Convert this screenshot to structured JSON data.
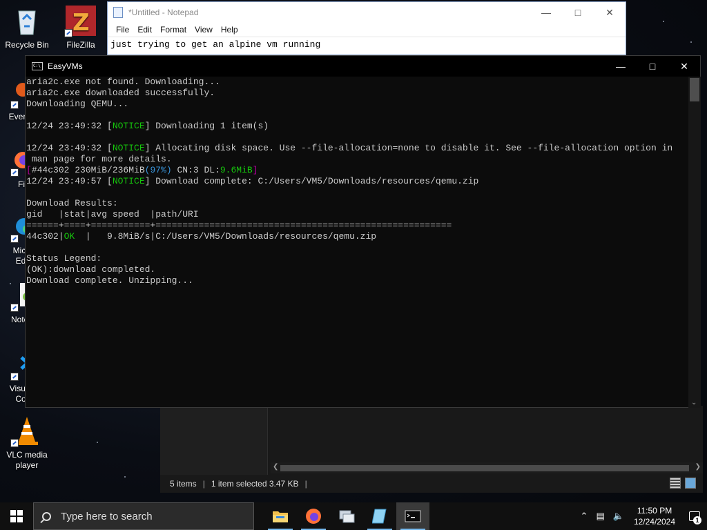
{
  "desktop": {
    "icons": [
      {
        "label": "Recycle Bin",
        "icon": "recycle-bin-icon"
      },
      {
        "label": "FileZilla",
        "icon": "filezilla-icon"
      },
      {
        "label": "Every",
        "icon": "everything-icon"
      },
      {
        "label": "Fir",
        "icon": "firefox-icon"
      },
      {
        "label": "Micr\nEd",
        "icon": "edge-icon"
      },
      {
        "label": "Notep",
        "icon": "notepad-plus-icon"
      },
      {
        "label": "Visual\nCo",
        "icon": "vscode-icon"
      },
      {
        "label": "VLC media\nplayer",
        "icon": "vlc-icon"
      }
    ]
  },
  "notepad": {
    "title": "*Untitled - Notepad",
    "menu": [
      "File",
      "Edit",
      "Format",
      "View",
      "Help"
    ],
    "content": "just trying to get an alpine vm running"
  },
  "console": {
    "title": "EasyVMs",
    "lines": [
      [
        {
          "t": "aria2c.exe not found. Downloading..."
        }
      ],
      [
        {
          "t": "aria2c.exe downloaded successfully."
        }
      ],
      [
        {
          "t": "Downloading QEMU..."
        }
      ],
      [
        {
          "t": ""
        }
      ],
      [
        {
          "t": "12/24 23:49:32 ["
        },
        {
          "t": "NOTICE",
          "c": "green"
        },
        {
          "t": "] Downloading 1 item(s)"
        }
      ],
      [
        {
          "t": ""
        }
      ],
      [
        {
          "t": "12/24 23:49:32 ["
        },
        {
          "t": "NOTICE",
          "c": "green"
        },
        {
          "t": "] Allocating disk space. Use --file-allocation=none to disable it. See --file-allocation option in"
        }
      ],
      [
        {
          "t": " man page for more details."
        }
      ],
      [
        {
          "t": "[",
          "c": "mag"
        },
        {
          "t": "#44c302 230MiB/236MiB"
        },
        {
          "t": "(97%)",
          "c": "cyan"
        },
        {
          "t": " CN:3 DL:"
        },
        {
          "t": "9.6MiB",
          "c": "green"
        },
        {
          "t": "]",
          "c": "mag"
        }
      ],
      [
        {
          "t": "12/24 23:49:57 ["
        },
        {
          "t": "NOTICE",
          "c": "green"
        },
        {
          "t": "] Download complete: C:/Users/VM5/Downloads/resources/qemu.zip"
        }
      ],
      [
        {
          "t": ""
        }
      ],
      [
        {
          "t": "Download Results:"
        }
      ],
      [
        {
          "t": "gid   |stat|avg speed  |path/URI"
        }
      ],
      [
        {
          "t": "======+====+===========+======================================================="
        }
      ],
      [
        {
          "t": "44c302|"
        },
        {
          "t": "OK",
          "c": "green"
        },
        {
          "t": "  |   9.8MiB/s|C:/Users/VM5/Downloads/resources/qemu.zip"
        }
      ],
      [
        {
          "t": ""
        }
      ],
      [
        {
          "t": "Status Legend:"
        }
      ],
      [
        {
          "t": "(OK):download completed."
        }
      ],
      [
        {
          "t": "Download complete. Unzipping..."
        }
      ]
    ]
  },
  "explorer": {
    "item_count": "5 items",
    "selection": "1 item selected  3.47 KB"
  },
  "taskbar": {
    "search_placeholder": "Type here to search",
    "apps": [
      "file-explorer-icon",
      "firefox-icon",
      "virtualbox-icon",
      "notepad-icon",
      "terminal-icon"
    ],
    "time": "11:50 PM",
    "date": "12/24/2024",
    "notification_count": "1"
  },
  "colors": {
    "console_bg": "#0c0c0c",
    "console_text": "#cccccc",
    "notice_green": "#16c60c",
    "percent_cyan": "#3a96dd",
    "bracket_magenta": "#b4009e",
    "taskbar_bg": "#101010"
  }
}
